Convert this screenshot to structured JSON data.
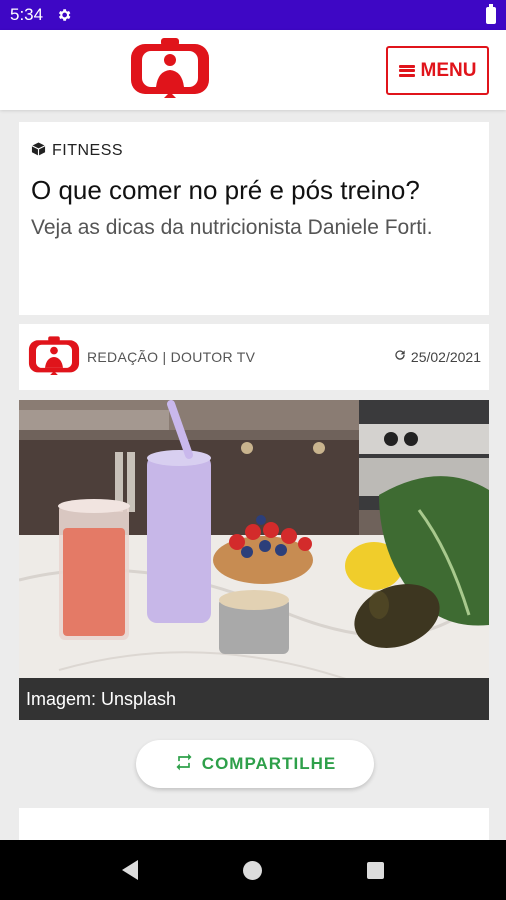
{
  "status": {
    "time": "5:34"
  },
  "header": {
    "menu_label": "MENU"
  },
  "article": {
    "category": "FITNESS",
    "title": "O que comer no pré e pós treino?",
    "subtitle": "Veja as dicas da nutricionista Daniele Forti.",
    "author": "REDAÇÃO | DOUTOR TV",
    "date": "25/02/2021",
    "image_caption": "Imagem: Unsplash"
  },
  "actions": {
    "share_label": "COMPARTILHE"
  },
  "colors": {
    "brand_red": "#e0141b",
    "status_bar": "#3e07c5",
    "share_green": "#2ea04a"
  },
  "icons": [
    "settings-gear-icon",
    "battery-icon",
    "menu-icon",
    "cube-icon",
    "refresh-icon",
    "share-repeat-icon",
    "nav-back-icon",
    "nav-home-icon",
    "nav-recent-icon"
  ]
}
